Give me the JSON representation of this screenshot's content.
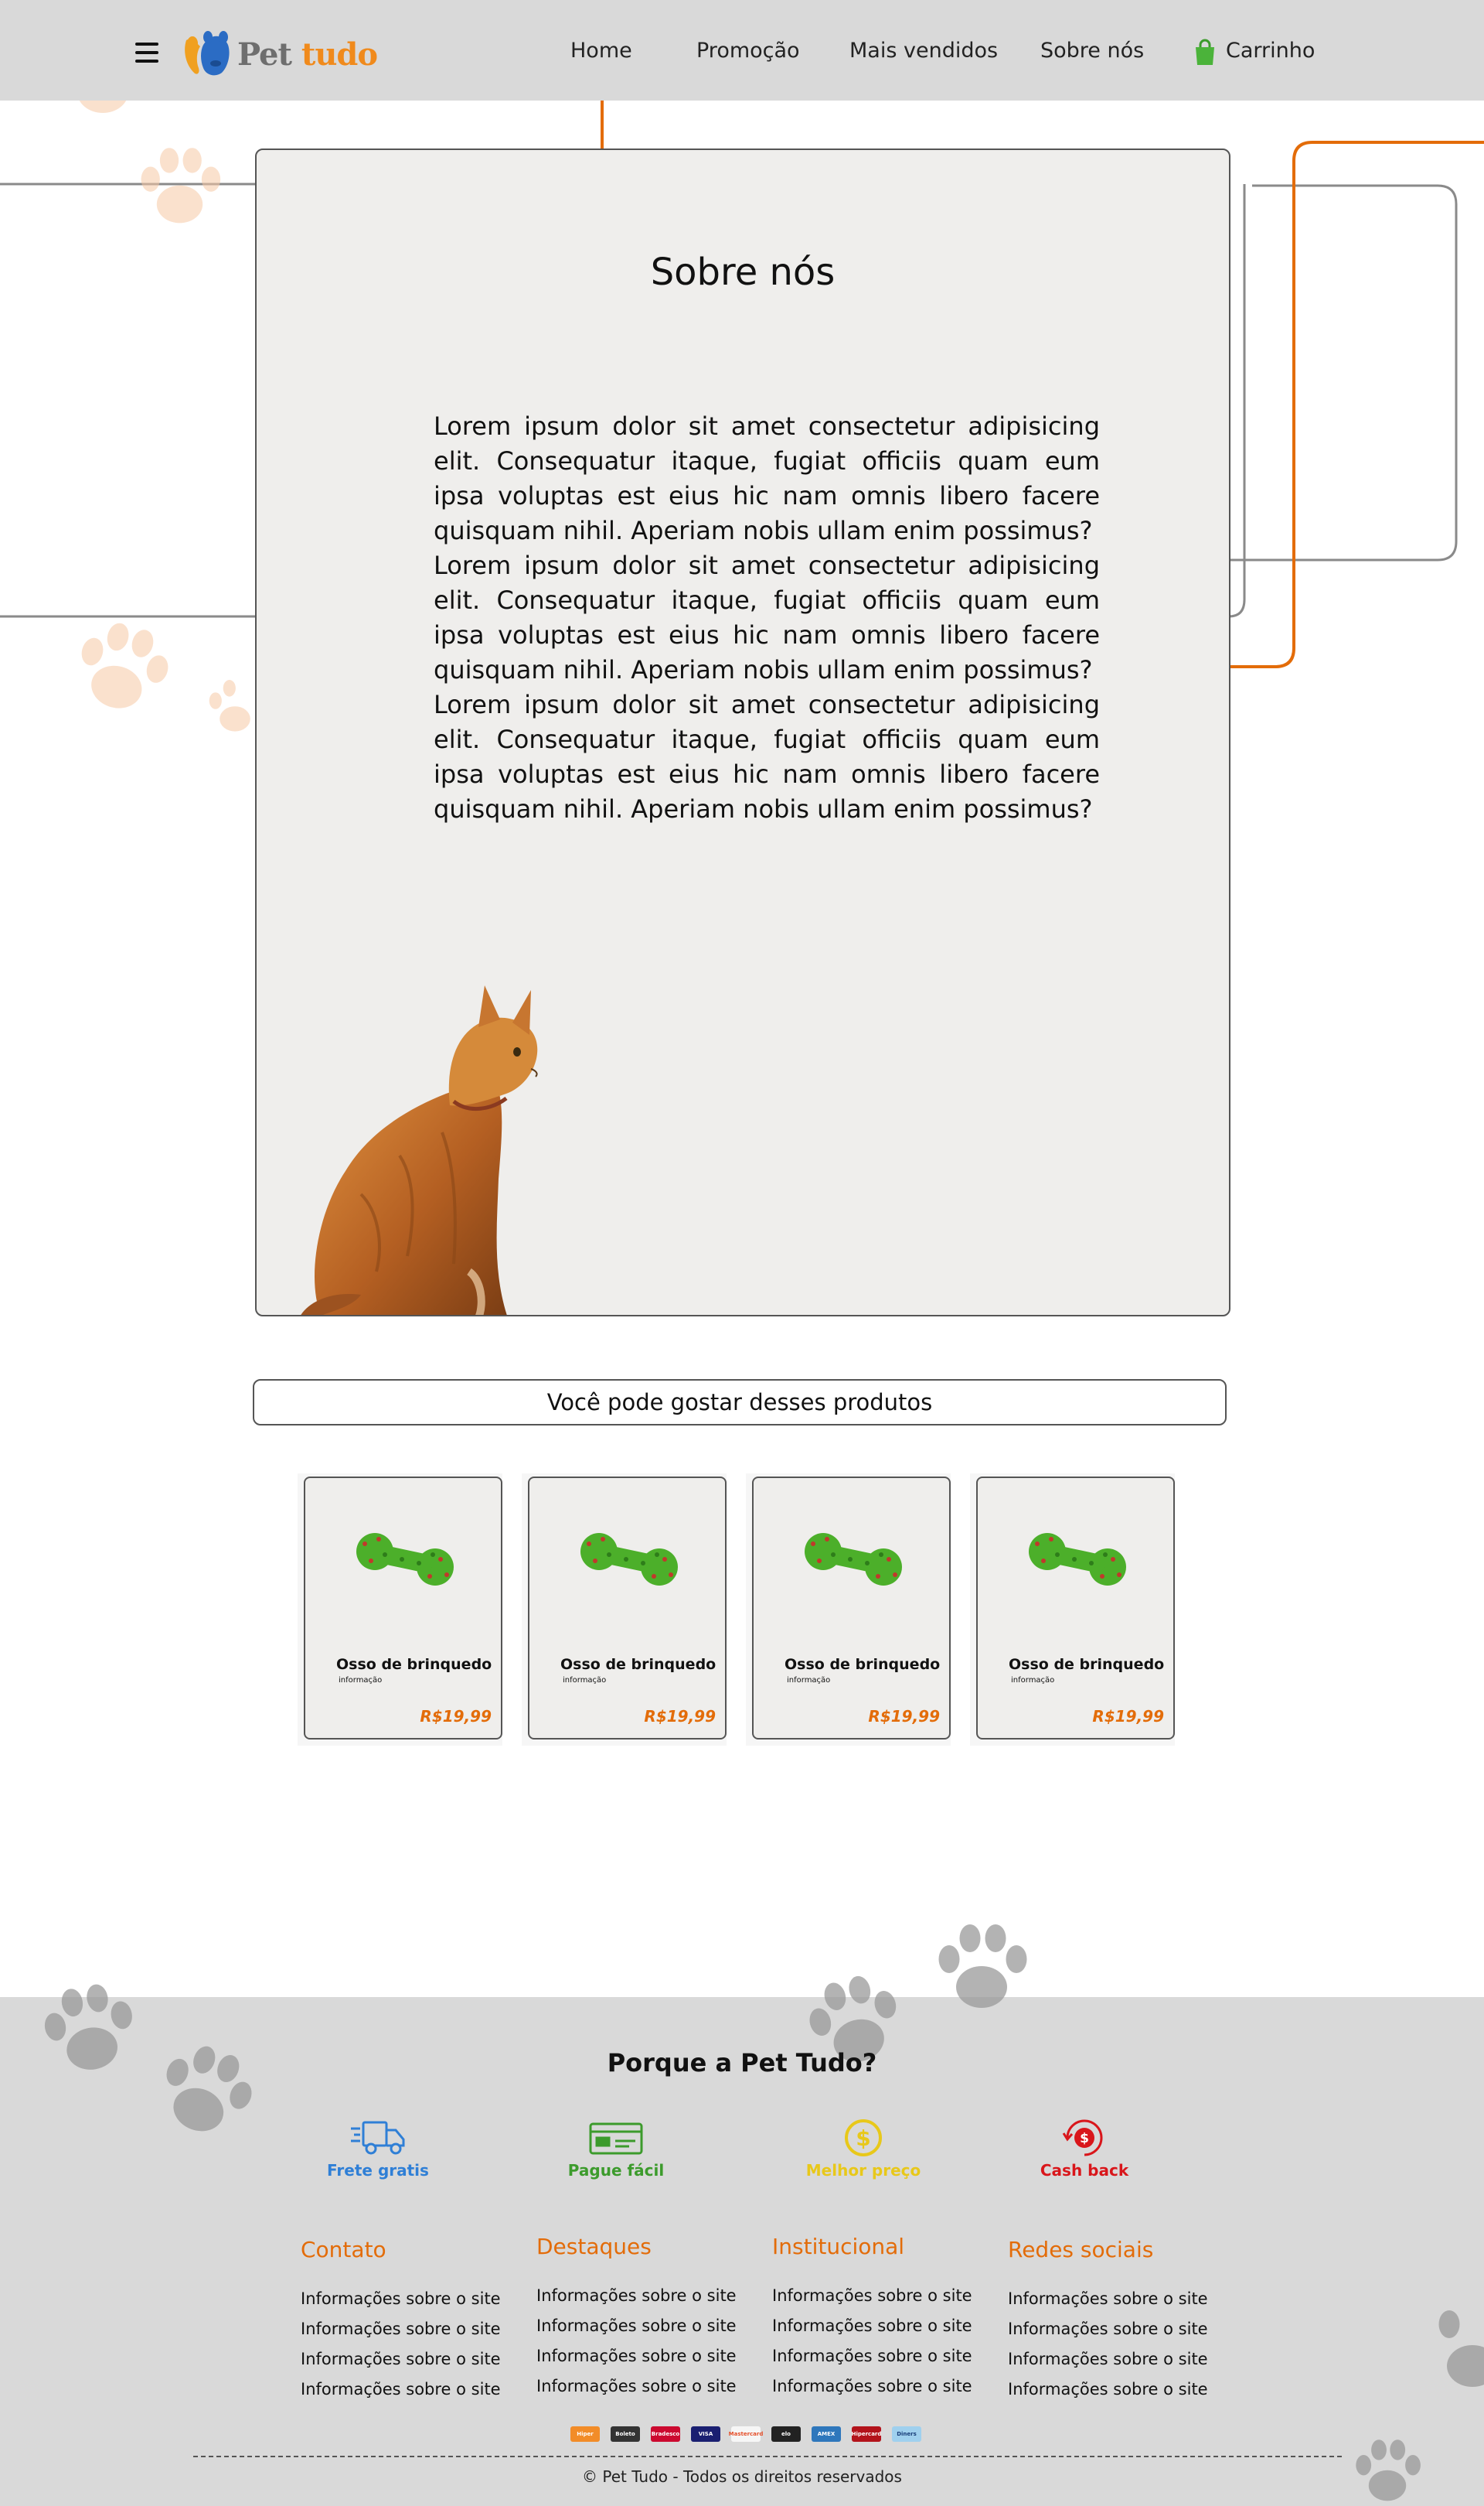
{
  "header": {
    "brand": {
      "part1": "Pet",
      "part2": "tudo"
    },
    "nav": [
      {
        "label": "Home"
      },
      {
        "label": "Promoção"
      },
      {
        "label": "Mais vendidos"
      },
      {
        "label": "Sobre nós"
      },
      {
        "label": "Carrinho"
      }
    ]
  },
  "about": {
    "title": "Sobre nós",
    "paragraphs": [
      "Lorem ipsum dolor sit amet consectetur adipisicing elit. Consequatur itaque, fugiat officiis quam eum ipsa voluptas est eius hic nam omnis libero facere quisquam nihil. Aperiam nobis ullam enim possimus?",
      "Lorem ipsum dolor sit amet consectetur adipisicing elit. Consequatur itaque, fugiat officiis quam eum ipsa voluptas est eius hic nam omnis libero facere quisquam nihil. Aperiam nobis ullam enim possimus?",
      "Lorem ipsum dolor sit amet consectetur adipisicing elit. Consequatur itaque, fugiat officiis quam eum ipsa voluptas est eius hic nam omnis libero facere quisquam nihil. Aperiam nobis ullam enim possimus?"
    ]
  },
  "suggestions": {
    "title": "Você pode gostar desses produtos",
    "products": [
      {
        "name": "Osso de brinquedo",
        "info": "informação",
        "price": "R$19,99"
      },
      {
        "name": "Osso de brinquedo",
        "info": "informação",
        "price": "R$19,99"
      },
      {
        "name": "Osso de brinquedo",
        "info": "informação",
        "price": "R$19,99"
      },
      {
        "name": "Osso de brinquedo",
        "info": "informação",
        "price": "R$19,99"
      }
    ]
  },
  "footer": {
    "why_title": "Porque a Pet Tudo?",
    "features": [
      {
        "label": "Frete gratis",
        "icon": "truck-icon",
        "color": "#2f7fd6"
      },
      {
        "label": "Pague fácil",
        "icon": "credit-card-icon",
        "color": "#3c9b2c"
      },
      {
        "label": "Melhor preço",
        "icon": "dollar-coin-icon",
        "color": "#e8c81a"
      },
      {
        "label": "Cash back",
        "icon": "cashback-icon",
        "color": "#d9161b"
      }
    ],
    "columns": [
      {
        "title": "Contato",
        "links": [
          "Informações sobre o site",
          "Informações sobre o site",
          "Informações sobre o site",
          "Informações sobre o site"
        ]
      },
      {
        "title": "Destaques",
        "links": [
          "Informações sobre o site",
          "Informações sobre o site",
          "Informações sobre o site",
          "Informações sobre o site"
        ]
      },
      {
        "title": "Institucional",
        "links": [
          "Informações sobre o site",
          "Informações sobre o site",
          "Informações sobre o site",
          "Informações sobre o site"
        ]
      },
      {
        "title": "Redes sociais",
        "links": [
          "Informações sobre o site",
          "Informações sobre o site",
          "Informações sobre o site",
          "Informações sobre o site"
        ]
      }
    ],
    "payments": [
      {
        "label": "Hiper",
        "color": "#f28c28"
      },
      {
        "label": "Boleto",
        "color": "#333333"
      },
      {
        "label": "Bradesco",
        "color": "#cc092f"
      },
      {
        "label": "VISA",
        "color": "#1a1f71"
      },
      {
        "label": "Mastercard",
        "color": "#f6f6f6"
      },
      {
        "label": "elo",
        "color": "#222222"
      },
      {
        "label": "AMEX",
        "color": "#2e77bc"
      },
      {
        "label": "Hipercard",
        "color": "#b3131b"
      },
      {
        "label": "Diners",
        "color": "#9fd0ee"
      }
    ],
    "copyright": "© Pet Tudo - Todos os direitos reservados"
  },
  "colors": {
    "accent": "#e36c09",
    "header_bg": "#d9d9d9",
    "card_bg": "#efeeec"
  }
}
